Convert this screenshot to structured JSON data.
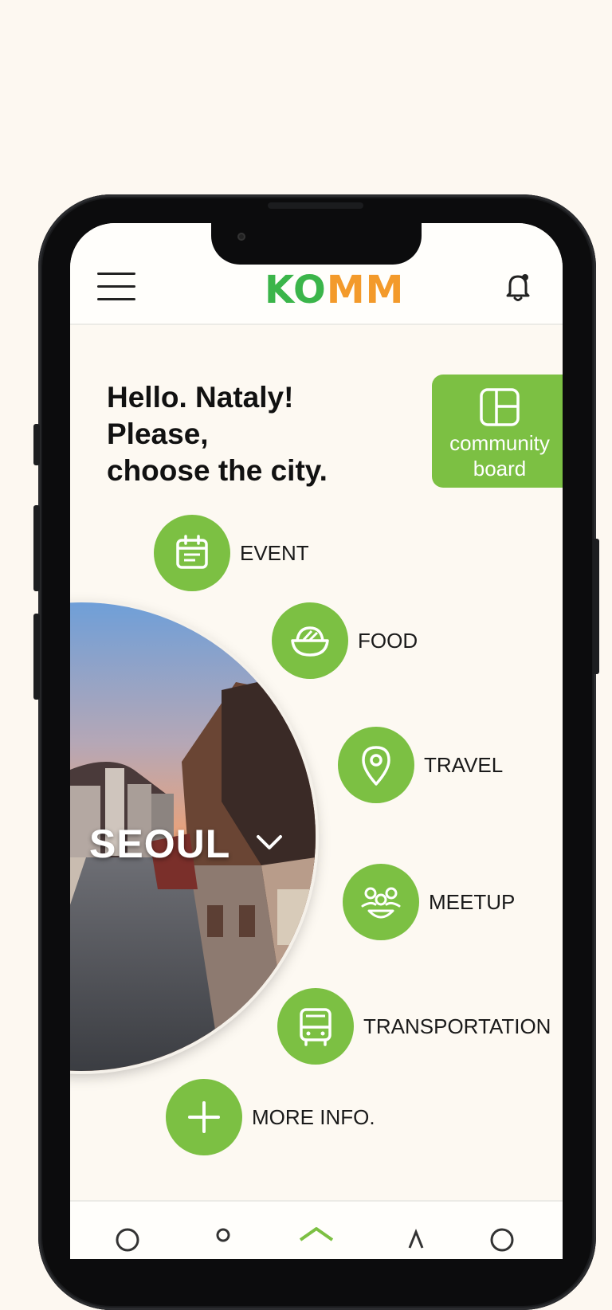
{
  "header": {
    "logo_part1": "KO",
    "logo_part2": "MM",
    "menu_icon": "hamburger-menu-icon",
    "notification_icon": "bell-icon"
  },
  "greeting": {
    "line1": "Hello. Nataly!",
    "line2": "Please,",
    "line3": "choose the city."
  },
  "community_board": {
    "line1": "community",
    "line2": "board",
    "icon": "layout-board-icon"
  },
  "city": {
    "name": "SEOUL"
  },
  "categories": [
    {
      "label": "EVENT",
      "icon": "calendar-icon"
    },
    {
      "label": "FOOD",
      "icon": "bowl-icon"
    },
    {
      "label": "TRAVEL",
      "icon": "location-pin-icon"
    },
    {
      "label": "MEETUP",
      "icon": "people-group-icon"
    },
    {
      "label": "TRANSPORTATION",
      "icon": "bus-icon"
    },
    {
      "label": "MORE INFO.",
      "icon": "plus-icon"
    }
  ],
  "colors": {
    "accent_green": "#7cc043",
    "logo_green": "#3bb54a",
    "logo_orange": "#f39a2b",
    "background": "#fdf8f1"
  }
}
